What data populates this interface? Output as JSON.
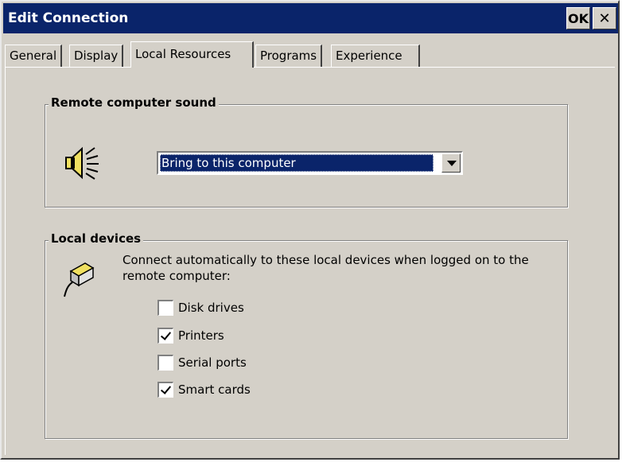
{
  "window": {
    "title": "Edit Connection",
    "ok_label": "OK",
    "close_label": "✕"
  },
  "tabs": [
    {
      "label": "General",
      "active": false
    },
    {
      "label": "Display",
      "active": false
    },
    {
      "label": "Local Resources",
      "active": true
    },
    {
      "label": "Programs",
      "active": false
    },
    {
      "label": "Experience",
      "active": false
    }
  ],
  "sound_group": {
    "legend": "Remote computer sound",
    "icon": "speaker-icon",
    "select_value": "Bring to this computer"
  },
  "devices_group": {
    "legend": "Local devices",
    "icon": "connector-icon",
    "description": "Connect automatically to these local devices when logged on to the remote computer:",
    "checkboxes": [
      {
        "label": "Disk drives",
        "checked": false
      },
      {
        "label": "Printers",
        "checked": true
      },
      {
        "label": "Serial ports",
        "checked": false
      },
      {
        "label": "Smart cards",
        "checked": true
      }
    ]
  },
  "colors": {
    "titlebar": "#0a246a",
    "face": "#d4d0c8",
    "highlight": "#0a246a"
  }
}
